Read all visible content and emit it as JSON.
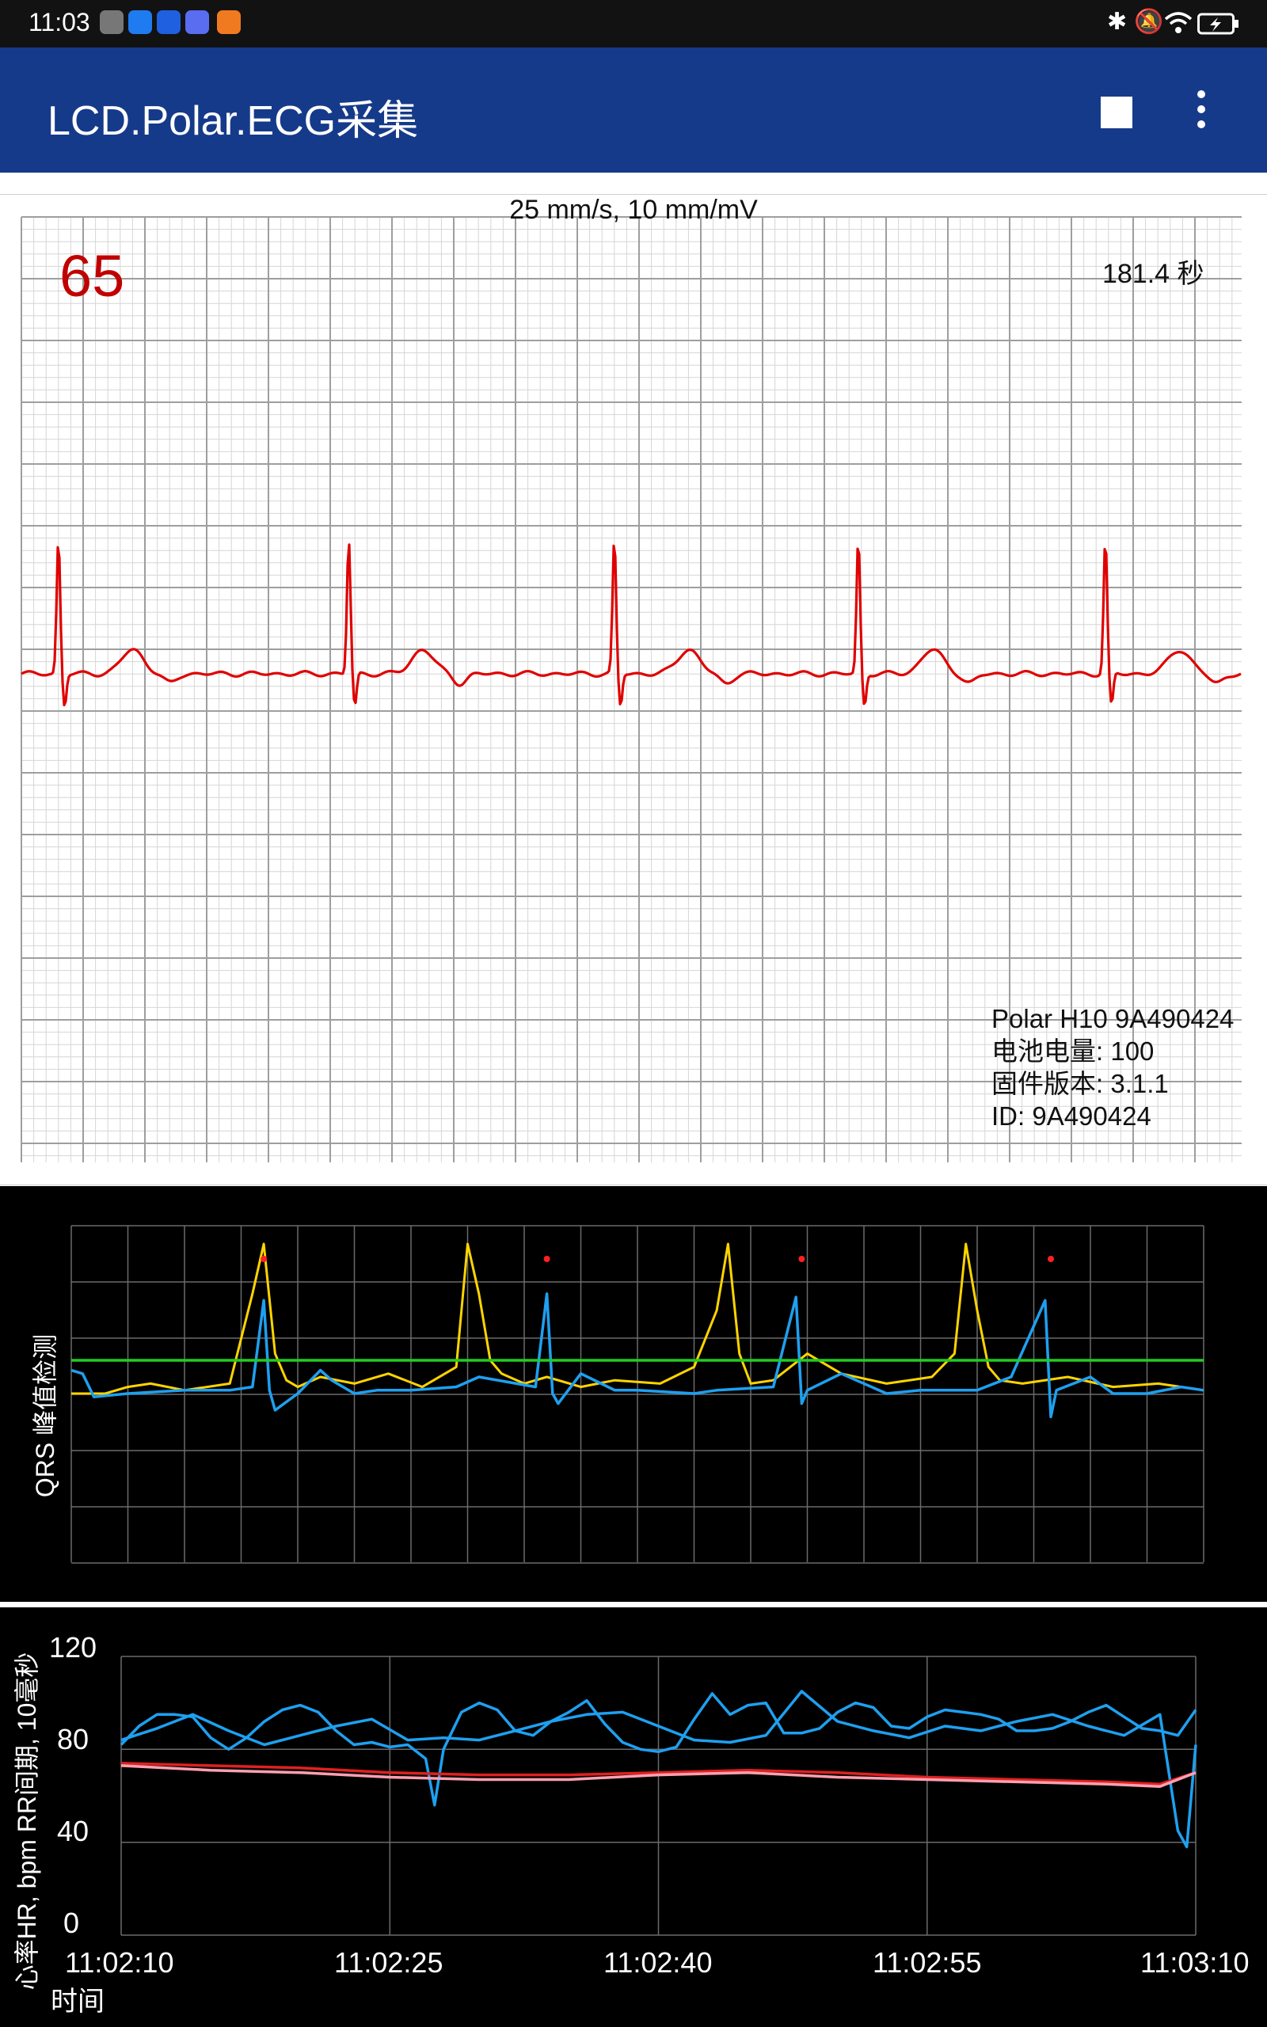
{
  "status_bar": {
    "time": "11:03",
    "notification_icons": [
      "hm-icon",
      "browser-icon",
      "bulb-icon",
      "music-icon",
      "video-icon"
    ],
    "system_icons": [
      "bluetooth-icon",
      "mute-icon",
      "wifi-icon",
      "battery-charging-icon"
    ]
  },
  "app_bar": {
    "title": "LCD.Polar.ECG采集",
    "accent_color": "#163a8a",
    "actions": [
      "stop-icon",
      "more-vert-icon"
    ]
  },
  "ecg": {
    "speed_label": "25 mm/s, 10 mm/mV",
    "heart_rate": "65",
    "elapsed": "181.4 秒",
    "trace_color": "#e00000",
    "device": {
      "name": "Polar H10 9A490424",
      "battery": "电池电量: 100",
      "firmware": "固件版本: 3.1.1",
      "id": "ID: 9A490424"
    },
    "r_peak_times_s": [
      0.12,
      1.06,
      1.92,
      2.71,
      3.51
    ]
  },
  "qrs_chart": {
    "ylabel": "QRS 峰值检测",
    "threshold_color": "#22cc22",
    "signal_color": "#ffd400",
    "filtered_color": "#1ea0f0",
    "peak_marker_color": "#ff2020"
  },
  "chart_data": [
    {
      "type": "line",
      "title": "QRS 峰值检测",
      "ylabel": "QRS 峰值检测",
      "series": [
        {
          "color": "#ffd400",
          "x": [
            0,
            3,
            5,
            7,
            10,
            14,
            16,
            17,
            18,
            19,
            20,
            22,
            25,
            28,
            31,
            34,
            35,
            36,
            37,
            38,
            40,
            42,
            45,
            48,
            52,
            55,
            57,
            58,
            59,
            60,
            62,
            65,
            68,
            72,
            76,
            78,
            79,
            80,
            81,
            82,
            84,
            88,
            92,
            96,
            100
          ],
          "y": [
            0,
            0,
            2,
            3,
            1,
            3,
            30,
            45,
            12,
            4,
            2,
            5,
            3,
            6,
            2,
            8,
            45,
            30,
            10,
            6,
            3,
            5,
            2,
            4,
            3,
            8,
            25,
            45,
            12,
            3,
            4,
            12,
            6,
            3,
            5,
            12,
            45,
            25,
            8,
            4,
            3,
            5,
            2,
            3,
            1
          ]
        },
        {
          "color": "#1ea0f0",
          "x": [
            0,
            1,
            2,
            5,
            10,
            14,
            16,
            17,
            17.5,
            18,
            20,
            22,
            23,
            25,
            27,
            30,
            34,
            36,
            41,
            42,
            42.5,
            43,
            45,
            48,
            50,
            55,
            57,
            62,
            64,
            64.5,
            65,
            68,
            72,
            75,
            80,
            83,
            86,
            86.5,
            87,
            90,
            92,
            95,
            98,
            100
          ],
          "y": [
            7,
            6,
            -1,
            0,
            1,
            1,
            2,
            28,
            1,
            -5,
            0,
            7,
            4,
            0,
            1,
            1,
            2,
            5,
            2,
            30,
            0,
            -3,
            6,
            1,
            1,
            0,
            1,
            2,
            29,
            -3,
            1,
            6,
            0,
            1,
            1,
            5,
            28,
            -7,
            1,
            5,
            0,
            0,
            2,
            1
          ]
        },
        {
          "color": "#22cc22",
          "x": [
            0,
            100
          ],
          "y": [
            10,
            10
          ]
        }
      ]
    },
    {
      "type": "line",
      "title": "",
      "xlabel": "时间",
      "ylabel": "心率HR, bpm RR间期, 10毫秒",
      "ylim": [
        0,
        120
      ],
      "y_ticks": [
        0,
        40,
        80,
        120
      ],
      "x_ticks": [
        "11:02:10",
        "11:02:25",
        "11:02:40",
        "11:02:55",
        "11:03:10"
      ],
      "grid": true,
      "series": [
        {
          "color": "#1ea0f0",
          "x": [
            0,
            1,
            2,
            3,
            4,
            5,
            6,
            7,
            8,
            9,
            10,
            11,
            12,
            13,
            14,
            15,
            16,
            17,
            17.5,
            18,
            19,
            20,
            21,
            22,
            23,
            24,
            25,
            26,
            27,
            28,
            29,
            30,
            31,
            32,
            33,
            34,
            35,
            36,
            37,
            38,
            39,
            40,
            41,
            42,
            43,
            44,
            45,
            46,
            47,
            48,
            49,
            50,
            51,
            52,
            53,
            54,
            55,
            56,
            57,
            58,
            59,
            60
          ],
          "y": [
            82,
            90,
            95,
            95,
            94,
            85,
            80,
            85,
            92,
            97,
            99,
            96,
            88,
            82,
            83,
            81,
            82,
            76,
            56,
            80,
            96,
            100,
            97,
            88,
            86,
            92,
            96,
            101,
            91,
            83,
            80,
            79,
            81,
            93,
            104,
            95,
            99,
            100,
            87,
            87,
            89,
            96,
            100,
            98,
            90,
            89,
            94,
            97,
            96,
            95,
            93,
            88,
            88,
            89,
            92,
            96,
            99,
            94,
            89,
            88,
            86,
            97
          ]
        },
        {
          "color": "#1ea0f0",
          "x": [
            0,
            2,
            4,
            6,
            8,
            10,
            12,
            14,
            16,
            18,
            20,
            22,
            24,
            26,
            28,
            30,
            32,
            34,
            36,
            38,
            40,
            42,
            44,
            46,
            48,
            50,
            52,
            54,
            56,
            58,
            59,
            59.5,
            60
          ],
          "y": [
            84,
            89,
            95,
            88,
            82,
            86,
            90,
            93,
            84,
            85,
            84,
            88,
            92,
            95,
            96,
            90,
            84,
            83,
            86,
            105,
            92,
            88,
            85,
            90,
            88,
            92,
            95,
            90,
            86,
            95,
            45,
            38,
            82
          ]
        },
        {
          "color": "#e02020",
          "x": [
            0,
            5,
            10,
            15,
            20,
            25,
            30,
            35,
            40,
            45,
            50,
            55,
            58,
            60
          ],
          "y": [
            74,
            73,
            72,
            70,
            69,
            69,
            70,
            71,
            70,
            68,
            67,
            66,
            65,
            70
          ]
        },
        {
          "color": "#ffa0b0",
          "x": [
            0,
            5,
            10,
            15,
            20,
            25,
            30,
            35,
            40,
            45,
            50,
            55,
            58,
            60
          ],
          "y": [
            73,
            71,
            70,
            68,
            67,
            67,
            69,
            70,
            68,
            67,
            66,
            65,
            64,
            70
          ]
        }
      ]
    }
  ]
}
